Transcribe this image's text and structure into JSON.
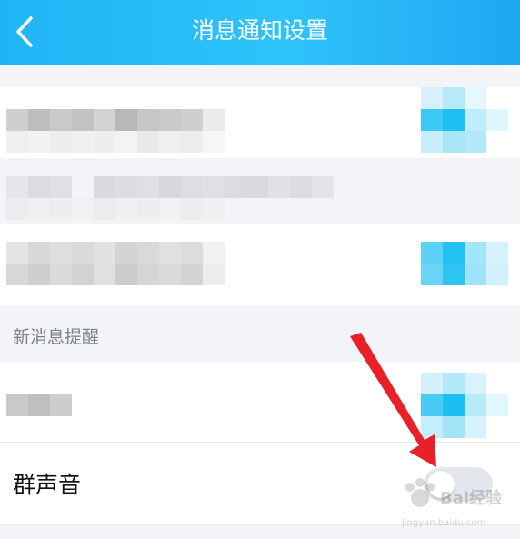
{
  "header": {
    "title": "消息通知设置",
    "back_icon": "chevron-left-icon",
    "background_color": "#1fb4f5"
  },
  "section": {
    "new_message_label": "新消息提醒"
  },
  "settings": {
    "group_sound_label": "群声音",
    "group_sound_on": false
  },
  "watermark": {
    "logo_text": "Bai经验",
    "site_text": "jingyan.baidu.com"
  },
  "colors": {
    "accent": "#1fb4f5",
    "arrow": "#e8202a",
    "toggle_off": "#e3e6ec"
  }
}
